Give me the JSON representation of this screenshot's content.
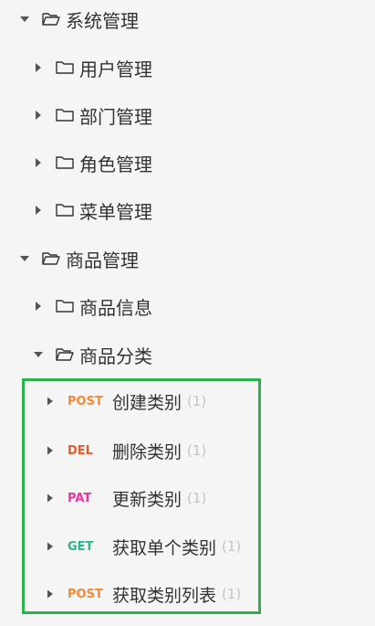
{
  "colors": {
    "post": "#f0893a",
    "del": "#e85a2a",
    "pat": "#e5399c",
    "get": "#2bb38a",
    "highlight_border": "#2bb24c"
  },
  "tree": {
    "system": {
      "label": "系统管理",
      "expanded": true,
      "icon": "folder-open-icon",
      "children": [
        "用户管理",
        "部门管理",
        "角色管理",
        "菜单管理"
      ]
    },
    "product": {
      "label": "商品管理",
      "expanded": true,
      "icon": "folder-open-icon",
      "info": {
        "label": "商品信息",
        "icon": "folder-icon"
      },
      "category": {
        "label": "商品分类",
        "expanded": true,
        "icon": "folder-open-icon"
      }
    }
  },
  "apis": [
    {
      "method": "POST",
      "name": "创建类别",
      "count": "(1)"
    },
    {
      "method": "DEL",
      "name": "删除类别",
      "count": "(1)"
    },
    {
      "method": "PAT",
      "name": "更新类别",
      "count": "(1)"
    },
    {
      "method": "GET",
      "name": "获取单个类别",
      "count": "(1)"
    },
    {
      "method": "POST",
      "name": "获取类别列表",
      "count": "(1)"
    }
  ]
}
